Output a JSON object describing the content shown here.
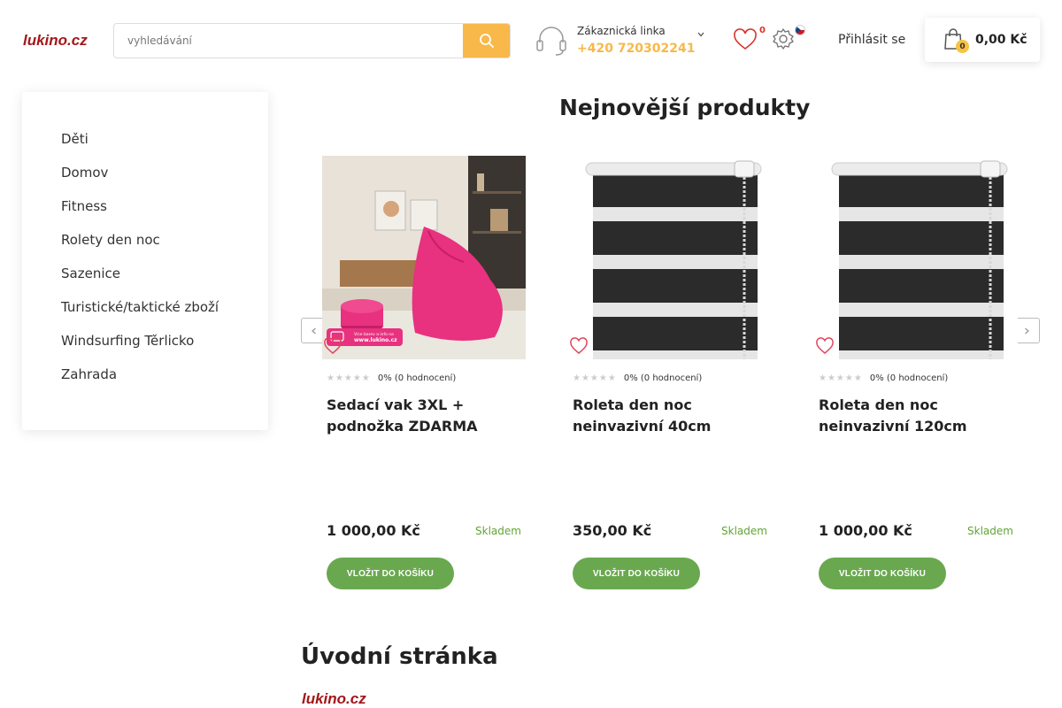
{
  "header": {
    "logo": "lukino.cz",
    "search_placeholder": "vyhledávání",
    "hotline_label": "Zákaznická linka",
    "hotline_phone": "+420 720302241",
    "wishlist_count": "0",
    "login_label": "Přihlásit se",
    "cart_count": "0",
    "cart_total": "0,00 Kč",
    "accent_color": "#f8b84a"
  },
  "sidebar": {
    "items": [
      {
        "label": "Děti"
      },
      {
        "label": "Domov"
      },
      {
        "label": "Fitness"
      },
      {
        "label": "Rolety den noc"
      },
      {
        "label": "Sazenice"
      },
      {
        "label": "Turistické/taktické zboží"
      },
      {
        "label": "Windsurfing Těrlicko"
      },
      {
        "label": "Zahrada"
      }
    ]
  },
  "main": {
    "section_title": "Nejnovější produkty",
    "products": [
      {
        "name": "Sedací vak 3XL + podnožka ZDARMA",
        "rating": "0% (0 hodnocení)",
        "price": "1 000,00 Kč",
        "stock": "Skladem",
        "button": "VLOŽIT DO KOŠÍKU",
        "image_banner": "Více barev a info na www.lukino.cz"
      },
      {
        "name": "Roleta den noc neinvazivní 40cm",
        "rating": "0% (0 hodnocení)",
        "price": "350,00 Kč",
        "stock": "Skladem",
        "button": "VLOŽIT DO KOŠÍKU"
      },
      {
        "name": "Roleta den noc neinvazivní 120cm",
        "rating": "0% (0 hodnocení)",
        "price": "1 000,00 Kč",
        "stock": "Skladem",
        "button": "VLOŽIT DO KOŠÍKU"
      }
    ],
    "page_title": "Úvodní stránka",
    "footer_logo": "lukino.cz"
  }
}
